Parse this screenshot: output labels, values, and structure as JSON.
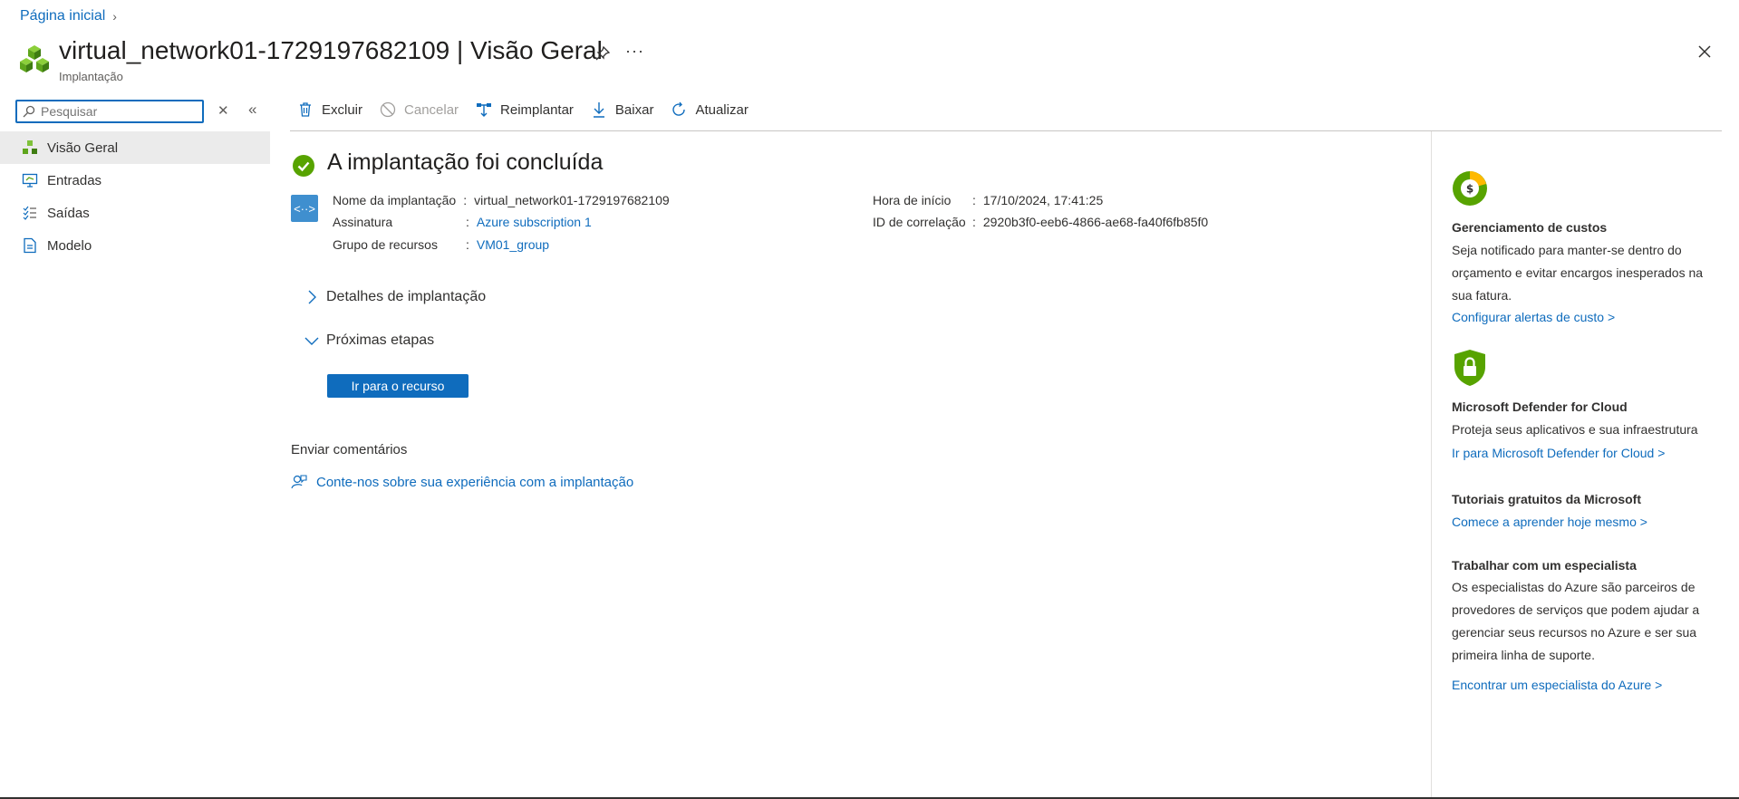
{
  "header": {
    "breadcrumb": "Página inicial",
    "title": "virtual_network01-1729197682109 | Visão Geral",
    "subtitle": "Implantação"
  },
  "sidebar": {
    "search_placeholder": "Pesquisar",
    "items": [
      {
        "label": "Visão Geral",
        "icon": "cubes-icon",
        "active": true
      },
      {
        "label": "Entradas",
        "icon": "monitor-icon"
      },
      {
        "label": "Saídas",
        "icon": "list-icon"
      },
      {
        "label": "Modelo",
        "icon": "document-icon"
      }
    ]
  },
  "toolbar": {
    "delete": "Excluir",
    "cancel": "Cancelar",
    "redeploy": "Reimplantar",
    "download": "Baixar",
    "refresh": "Atualizar"
  },
  "main": {
    "status_title": "A implantação foi concluída",
    "details": {
      "deployment_name_label": "Nome da implantação",
      "deployment_name_value": "virtual_network01-1729197682109",
      "subscription_label": "Assinatura",
      "subscription_value": "Azure subscription 1",
      "resource_group_label": "Grupo de recursos",
      "resource_group_value": "VM01_group",
      "start_time_label": "Hora de início",
      "start_time_value": "17/10/2024, 17:41:25",
      "correlation_label": "ID de correlação",
      "correlation_value": "2920b3f0-eeb6-4866-ae68-fa40f6fb85f0"
    },
    "deploy_details_label": "Detalhes de implantação",
    "next_steps_label": "Próximas etapas",
    "go_to_resource": "Ir para o recurso",
    "feedback_heading": "Enviar comentários",
    "feedback_link": "Conte-nos sobre sua experiência com a implantação"
  },
  "right_panel": {
    "cost": {
      "title": "Gerenciamento de custos",
      "text": "Seja notificado para manter-se dentro do orçamento e evitar encargos inesperados na sua fatura.",
      "link": "Configurar alertas de custo >"
    },
    "defender": {
      "title": "Microsoft Defender for Cloud",
      "text": "Proteja seus aplicativos e sua infraestrutura",
      "link": "Ir para Microsoft Defender for Cloud >"
    },
    "tutorials": {
      "title": "Tutoriais gratuitos da Microsoft",
      "link": "Comece a aprender hoje mesmo >"
    },
    "expert": {
      "title": "Trabalhar com um especialista",
      "text": "Os especialistas do Azure são parceiros de provedores de serviços que podem ajudar a gerenciar seus recursos no Azure e ser sua primeira linha de suporte.",
      "link": "Encontrar um especialista do Azure >"
    }
  },
  "colors": {
    "accent": "#0f6cbd",
    "success": "#57a300",
    "nav_active_bg": "#ebebeb"
  }
}
